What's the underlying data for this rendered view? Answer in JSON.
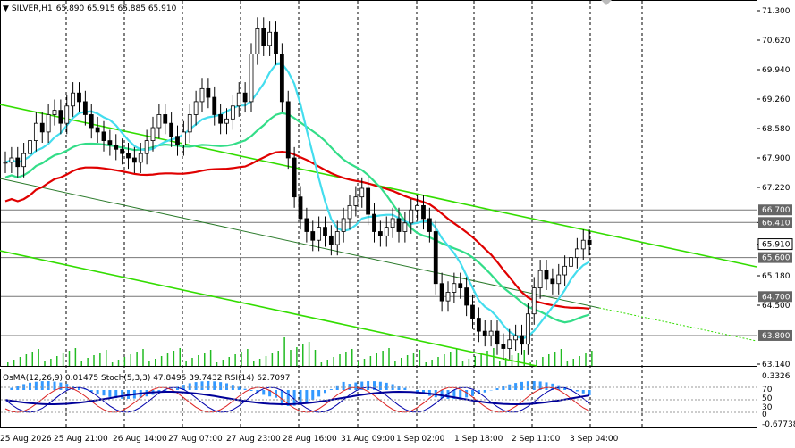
{
  "header": {
    "symbol": "SILVER,H1",
    "ohlc": "65.890 65.915 65.885 65.910"
  },
  "indicator_header": "OsMA(12,26,9) 0.01475  Stoch(5,3,3) 47.8495 39.7432  RSI(14) 62.7097",
  "colors": {
    "price_bar": "#000000",
    "ema_red": "#e00000",
    "ema_green": "#33dd88",
    "ema_cyan": "#44ddee",
    "channel_green": "#33dd00",
    "osma_bar": "#3399ff",
    "stoch_main": "#0000aa",
    "stoch_signal": "#dd2222",
    "rsi": "#000099",
    "grid": "#000000",
    "level_line": "#555555"
  },
  "chart_data": {
    "type": "candlestick",
    "symbol": "SILVER",
    "timeframe": "H1",
    "price_axis_ticks": [
      "71.300",
      "70.620",
      "69.940",
      "69.260",
      "68.580",
      "67.900",
      "67.220",
      "66.410",
      "65.910",
      "65.180",
      "64.500",
      "63.140"
    ],
    "price_axis_range": [
      63.14,
      71.3
    ],
    "level_tags": [
      "66.700",
      "66.410",
      "65.910",
      "65.600",
      "64.700",
      "63.800"
    ],
    "current_price": 65.91,
    "time_labels": [
      "25 Aug 2026",
      "25 Aug 21:00",
      "26 Aug 14:00",
      "27 Aug 07:00",
      "27 Aug 23:00",
      "28 Aug 16:00",
      "31 Aug 09:00",
      "1 Sep 02:00",
      "1 Sep 18:00",
      "2 Sep 11:00",
      "3 Sep 04:00"
    ],
    "closes": [
      67.8,
      67.9,
      67.7,
      68.0,
      68.3,
      68.7,
      68.5,
      68.9,
      69.0,
      68.7,
      69.1,
      69.4,
      69.2,
      68.9,
      68.6,
      68.5,
      68.3,
      68.2,
      68.1,
      68.0,
      67.9,
      67.8,
      68.0,
      68.3,
      68.6,
      68.9,
      68.7,
      68.4,
      68.2,
      68.5,
      68.9,
      69.2,
      69.5,
      69.3,
      68.9,
      68.7,
      68.8,
      69.1,
      69.4,
      69.2,
      70.3,
      70.9,
      70.5,
      70.8,
      70.3,
      69.2,
      67.9,
      67.0,
      66.5,
      66.2,
      66.0,
      66.3,
      66.1,
      65.9,
      66.2,
      66.5,
      66.8,
      67.0,
      67.2,
      66.6,
      66.2,
      66.1,
      66.3,
      66.5,
      66.2,
      66.4,
      66.7,
      66.8,
      66.5,
      66.2,
      65.0,
      64.6,
      64.8,
      65.0,
      64.9,
      64.5,
      64.2,
      63.9,
      63.8,
      63.9,
      63.6,
      63.5,
      63.7,
      63.8,
      63.6,
      64.3,
      64.9,
      65.3,
      65.1,
      65.0,
      65.2,
      65.4,
      65.6,
      65.8,
      66.0,
      65.9
    ],
    "indicators": [
      "OsMA(12,26,9) 0.01475",
      "Stoch(5,3,3) 47.8495 39.7432",
      "RSI(14) 62.7097"
    ],
    "indicator_axis_ticks": [
      "0.3326",
      "70",
      "50",
      "30",
      "0",
      "-0.67738"
    ]
  }
}
